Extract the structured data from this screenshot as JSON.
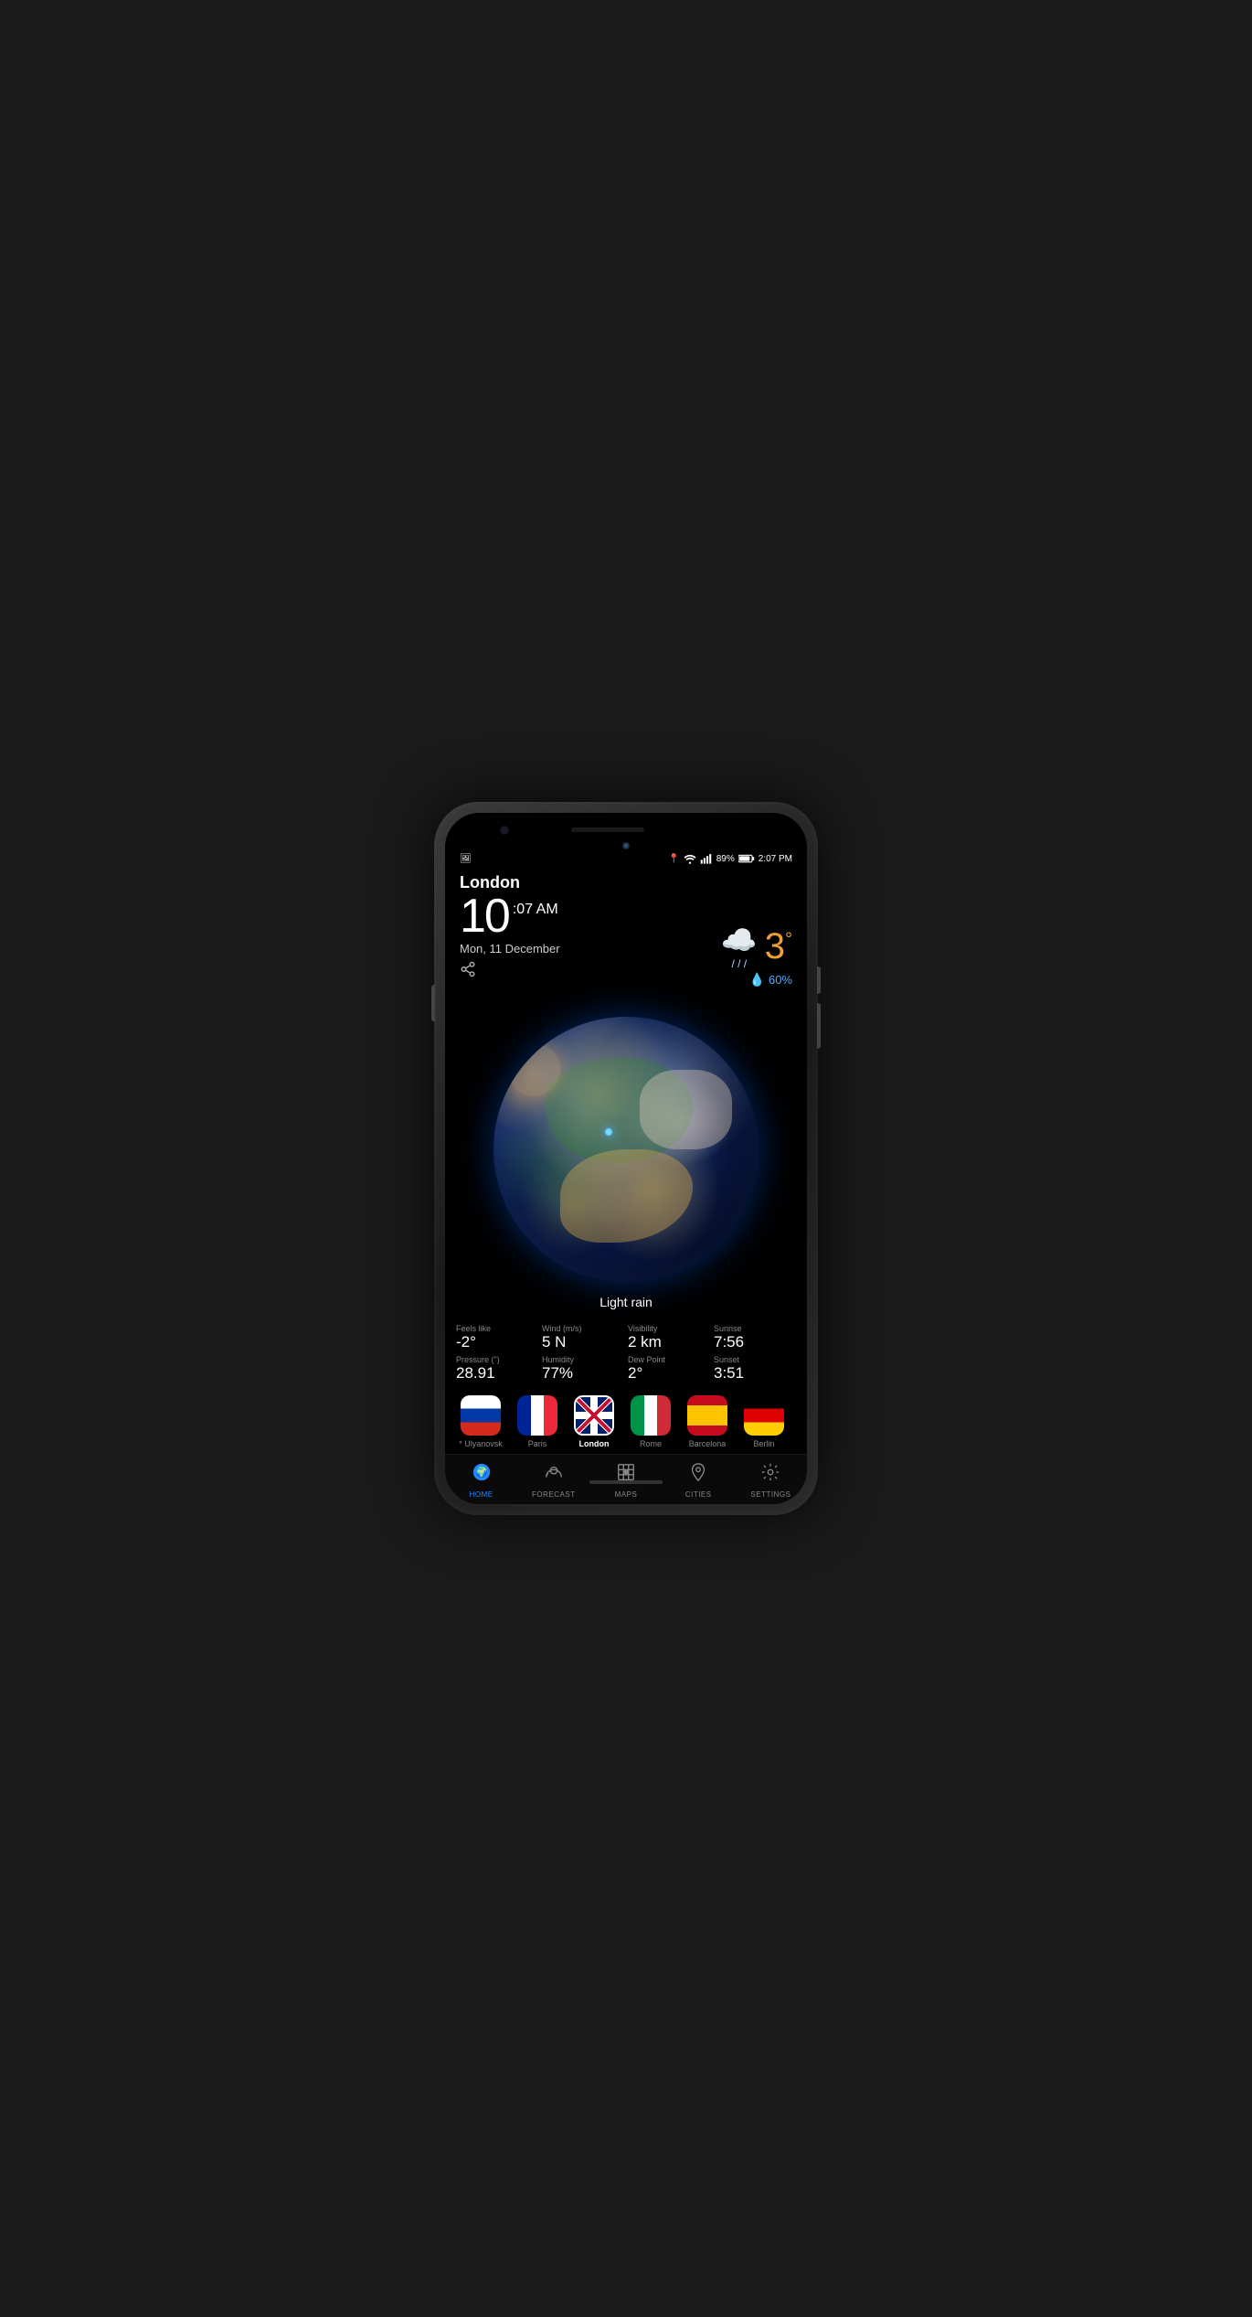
{
  "phone": {
    "status_bar": {
      "location_icon": "📍",
      "wifi_icon": "wifi",
      "signal_icon": "signal",
      "battery": "89%",
      "time": "2:07 PM"
    },
    "weather": {
      "city": "London",
      "time_hour": "10",
      "time_minute": ":07",
      "time_ampm": "AM",
      "date": "Mon, 11 December",
      "temperature": "3",
      "temp_unit": "°",
      "humidity": "60%",
      "condition": "Light rain",
      "feels_like_label": "Feels like",
      "feels_like": "-2°",
      "wind_label": "Wind (m/s)",
      "wind": "5 N",
      "visibility_label": "Visibility",
      "visibility": "2 km",
      "sunrise_label": "Sunrise",
      "sunrise": "7:56",
      "pressure_label": "Pressure (\")",
      "pressure": "28.91",
      "humidity_label": "Humidity",
      "humidity_stat": "77%",
      "dew_point_label": "Dew Point",
      "dew_point": "2°",
      "sunset_label": "Sunset",
      "sunset": "3:51"
    },
    "cities": [
      {
        "name": "* Ulyanovsk",
        "flag": "russia",
        "active": false
      },
      {
        "name": "Paris",
        "flag": "france",
        "active": false
      },
      {
        "name": "London",
        "flag": "uk",
        "active": true
      },
      {
        "name": "Rome",
        "flag": "italy",
        "active": false
      },
      {
        "name": "Barcelona",
        "flag": "spain",
        "active": false
      },
      {
        "name": "Berlin",
        "flag": "germany",
        "active": false
      }
    ],
    "nav": [
      {
        "id": "home",
        "label": "HOME",
        "active": true
      },
      {
        "id": "forecast",
        "label": "FORECAST",
        "active": false
      },
      {
        "id": "maps",
        "label": "MAPS",
        "active": false
      },
      {
        "id": "cities",
        "label": "CITIES",
        "active": false
      },
      {
        "id": "settings",
        "label": "SETTINGS",
        "active": false
      }
    ]
  }
}
